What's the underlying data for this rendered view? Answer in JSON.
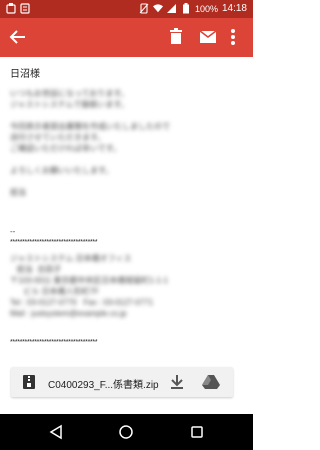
{
  "status_bar": {
    "battery_percent": "100%",
    "time": "14:18"
  },
  "app_bar": {
    "color": "#db4437",
    "back_icon": "arrow-left-icon",
    "delete_icon": "trash-icon",
    "mail_icon": "envelope-icon",
    "more_icon": "more-vert-icon"
  },
  "message": {
    "greeting": "日沼様",
    "blurred_text": "いつもお世話になっております。\nジャストシステムで御座います。\n\n今回表示者提出書類を作成いたしましたので\n送付させていただきます。\nご確認いただければ幸いです。\n\nよろしくお願いいたします。\n\n担当",
    "dash": "--",
    "separator": "************************************",
    "blurred_signature": "ジャストシステム 日本橋オフィス\n   担当  吉田子\n〒103-0011 東京都中央区日本橋堀留町1-1-1\n      ビル 日本橋人形町7F\nTel : 03-0127-0770   Fax : 03-0127-0771\nMail : justsystem@example.co.jp"
  },
  "attachment": {
    "file_name": "C0400293_F...係書類.zip",
    "zip_icon": "zip-file-icon",
    "download_icon": "download-icon",
    "drive_icon": "drive-icon"
  },
  "nav_bar": {
    "back_icon": "triangle-back-icon",
    "home_icon": "circle-home-icon",
    "recents_icon": "square-recents-icon"
  }
}
